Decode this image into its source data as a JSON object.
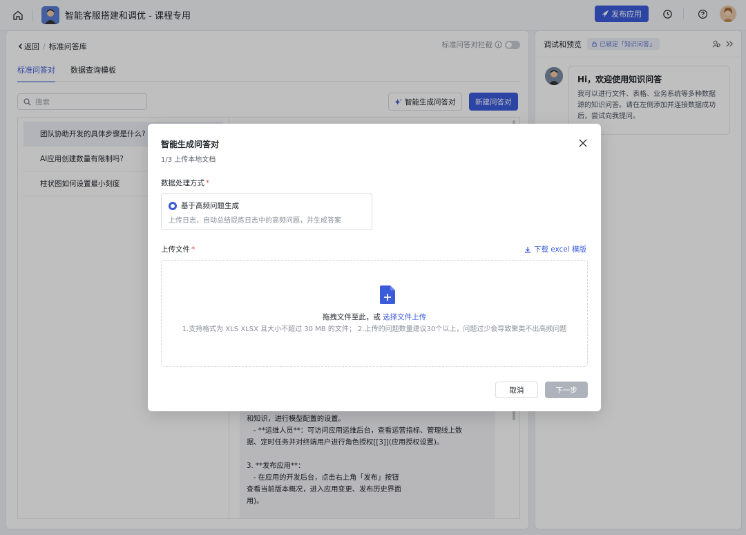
{
  "topbar": {
    "app_title": "智能客服搭建和调优 - 课程专用",
    "publish_label": "发布应用"
  },
  "left": {
    "back_label": "返回",
    "breadcrumb_current": "标准问答库",
    "intercept_label": "标准问答对拦截",
    "tabs": [
      {
        "label": "标准问答对"
      },
      {
        "label": "数据查询模板"
      }
    ],
    "search_placeholder": "搜索",
    "ai_generate_label": "智能生成问答对",
    "new_label": "新建问答对",
    "qa_list": [
      {
        "label": "团队协助开发的具体步骤是什么?"
      },
      {
        "label": "AI应用创建数量有限制吗?"
      },
      {
        "label": "柱状图如何设置最小刻度"
      }
    ],
    "answer_lines": [
      "和知识，进行模型配置的设置。",
      "   - **运维人员**：可访问应用运维后台，查看运营指标、管理线上数",
      "据、定时任务并对终端用户进行角色授权[[3]](应用授权设置)。",
      "",
      "3. **发布应用**：",
      "   - 在应用的开发后台，点击右上角「发布」按钮",
      "查看当前版本概况，进入应用变更、发布历史界面",
      "用)。"
    ]
  },
  "right": {
    "title": "调试和预览",
    "locked_tag": "已锁定「知识问答」",
    "welcome_title": "Hi，欢迎使用知识问答",
    "welcome_text": "我可以进行文件、表格、业务系统等多种数据源的知识问答。请在左侧添加并连接数据成功后，尝试向我提问。"
  },
  "modal": {
    "title": "智能生成问答对",
    "step": "1/3 上传本地文档",
    "method_label": "数据处理方式",
    "option_title": "基于高频问题生成",
    "option_desc": "上传日志，自动总结提炼日志中的高频问题，并生成答案",
    "upload_label": "上传文件",
    "download_label": "下载 excel 模版",
    "drag_text": "拖拽文件至此，或 ",
    "choose_file": "选择文件上传",
    "hint": "1.支持格式为 XLS XLSX 且大小不超过 30 MB 的文件； 2.上传的问题数量建议30个以上，问题过少会导致聚类不出高频问题",
    "cancel_label": "取消",
    "next_label": "下一步"
  },
  "colors": {
    "accent": "#3b5bdb",
    "required": "#e54d42"
  }
}
